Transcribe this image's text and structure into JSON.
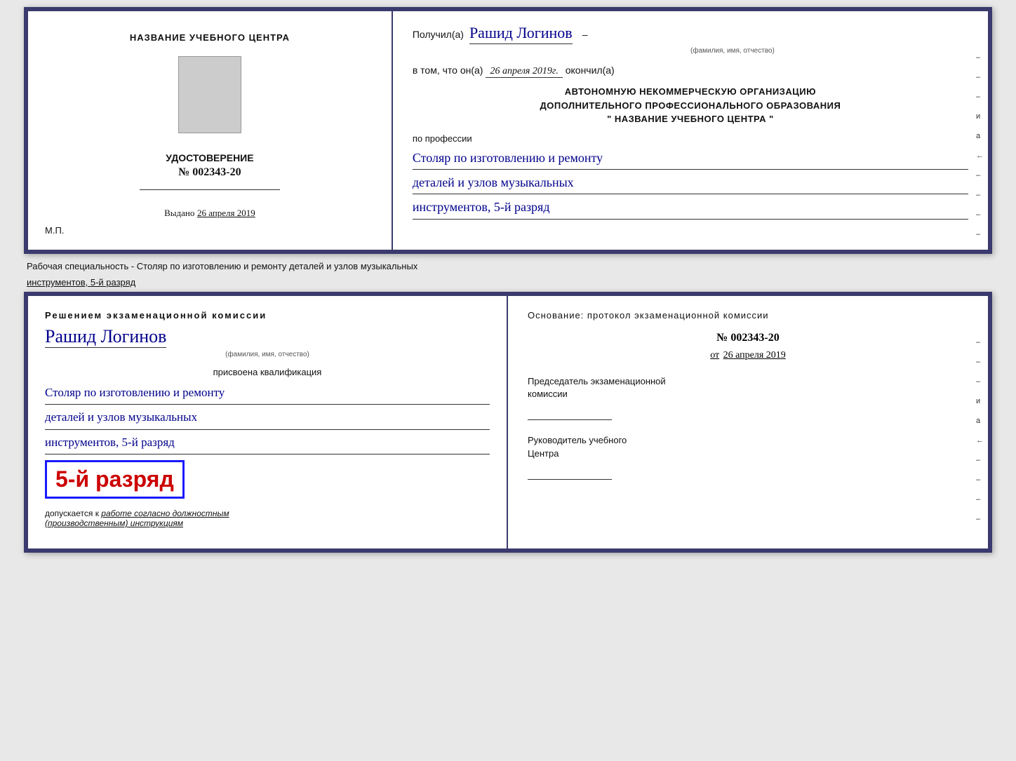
{
  "top_card": {
    "left": {
      "org_name": "НАЗВАНИЕ УЧЕБНОГО ЦЕНТРА",
      "cert_title": "УДОСТОВЕРЕНИЕ",
      "cert_number": "№ 002343-20",
      "issued_label": "Выдано",
      "issued_date": "26 апреля 2019",
      "mp_label": "М.П."
    },
    "right": {
      "received_label": "Получил(а)",
      "recipient_name": "Рашид Логинов",
      "fio_label": "(фамилия, имя, отчество)",
      "date_prefix": "в том, что он(а)",
      "date_value": "26 апреля 2019г.",
      "date_suffix": "окончил(а)",
      "org_block_line1": "АВТОНОМНУЮ НЕКОММЕРЧЕСКУЮ ОРГАНИЗАЦИЮ",
      "org_block_line2": "ДОПОЛНИТЕЛЬНОГО ПРОФЕССИОНАЛЬНОГО ОБРАЗОВАНИЯ",
      "org_block_line3": "\"   НАЗВАНИЕ УЧЕБНОГО ЦЕНТРА   \"",
      "profession_label": "по профессии",
      "profession_line1": "Столяр по изготовлению и ремонту",
      "profession_line2": "деталей и узлов музыкальных",
      "profession_line3": "инструментов, 5-й разряд"
    }
  },
  "specialty_label": "Рабочая специальность - Столяр по изготовлению и ремонту деталей и узлов музыкальных",
  "specialty_label2": "инструментов, 5-й разряд",
  "bottom_card": {
    "left": {
      "decision_title": "Решением экзаменационной комиссии",
      "person_name": "Рашид Логинов",
      "fio_label": "(фамилия, имя, отчество)",
      "qualification_label": "присвоена квалификация",
      "qual_line1": "Столяр по изготовлению и ремонту",
      "qual_line2": "деталей и узлов музыкальных",
      "qual_line3": "инструментов, 5-й разряд",
      "rank_text": "5-й разряд",
      "допускается_label": "допускается к",
      "допускается_text": "работе согласно должностным",
      "допускается_text2": "(производственным) инструкциям"
    },
    "right": {
      "basis_label": "Основание: протокол экзаменационной комиссии",
      "protocol_number": "№ 002343-20",
      "from_label": "от",
      "from_date": "26 апреля 2019",
      "chairman_label": "Председатель экзаменационной",
      "chairman_label2": "комиссии",
      "head_label": "Руководитель учебного",
      "head_label2": "Центра"
    }
  },
  "side_marks": [
    "-",
    "-",
    "-",
    "и",
    "а",
    "←",
    "-",
    "-",
    "-",
    "-"
  ]
}
